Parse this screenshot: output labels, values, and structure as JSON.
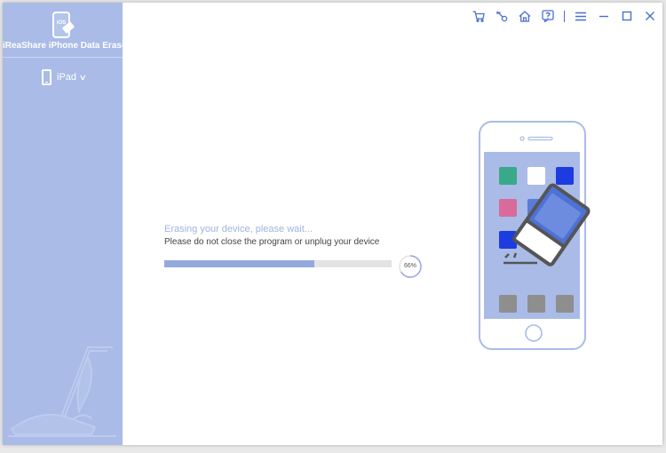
{
  "app": {
    "title": "iReaShare iPhone Data Eraser",
    "logo_badge": "iOS",
    "device": "iPad"
  },
  "titlebar": {
    "icons": [
      "cart-icon",
      "key-icon",
      "home-icon",
      "help-icon",
      "menu-icon",
      "minimize-icon",
      "maximize-icon",
      "close-icon"
    ]
  },
  "progress": {
    "title": "Erasing your device, please wait...",
    "note": "Please do not close the program or unplug your device",
    "percent_label": "66%",
    "fraction": 0.66
  },
  "colors": {
    "sidebar": "#a9bbe6",
    "accent": "#4a6fd0",
    "progress_fill": "#94a9de",
    "app_icons": [
      "#3aa98a",
      "#ffffff",
      "#1c3be0",
      "#d96b9a",
      "#5b7bd8",
      "#1c3be0",
      "#8e8e8e",
      "#8e8e8e",
      "#8e8e8e"
    ]
  }
}
